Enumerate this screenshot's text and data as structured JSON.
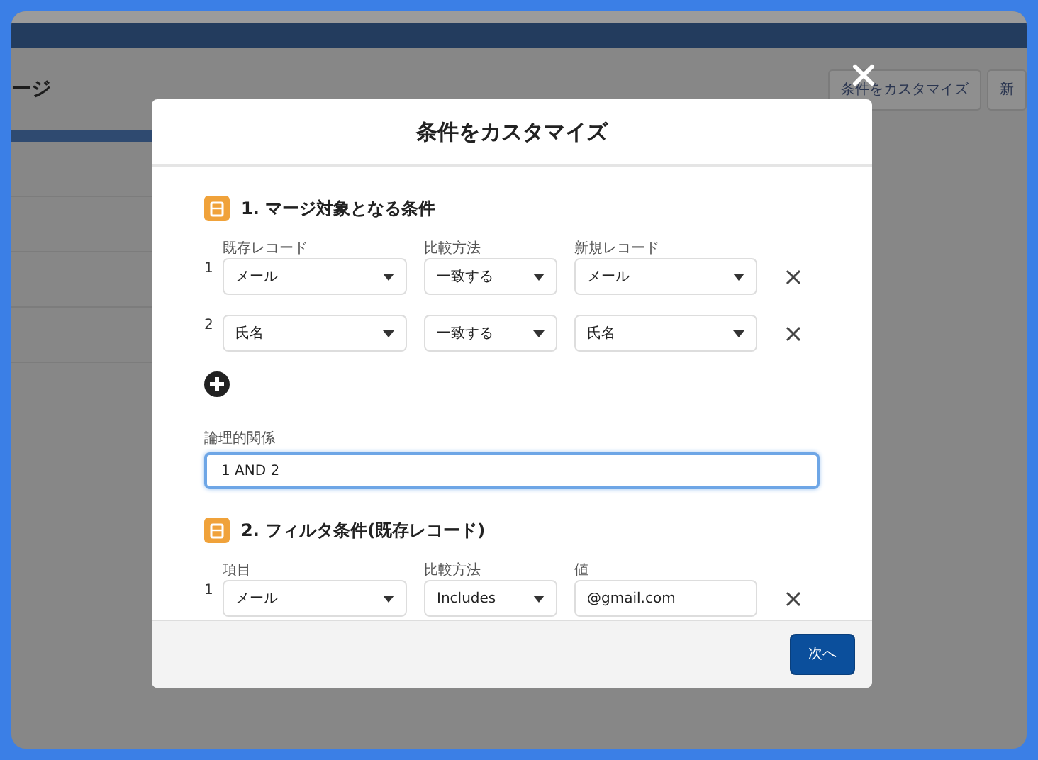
{
  "background": {
    "page_title": "ージ",
    "header_buttons": [
      "条件をカスタマイズ",
      "新"
    ]
  },
  "modal": {
    "title": "条件をカスタマイズ",
    "sections": [
      {
        "heading": "1. マージ対象となる条件",
        "columns": [
          "既存レコード",
          "比較方法",
          "新規レコード"
        ],
        "rows": [
          {
            "number": "1",
            "cells": [
              {
                "kind": "select",
                "value": "メール"
              },
              {
                "kind": "select",
                "value": "一致する"
              },
              {
                "kind": "select",
                "value": "メール"
              }
            ]
          },
          {
            "number": "2",
            "cells": [
              {
                "kind": "select",
                "value": "氏名"
              },
              {
                "kind": "select",
                "value": "一致する"
              },
              {
                "kind": "select",
                "value": "氏名"
              }
            ]
          }
        ],
        "add_row": true,
        "logic": {
          "label": "論理的関係",
          "value": "1 AND 2",
          "focused": true
        }
      },
      {
        "heading": "2. フィルタ条件(既存レコード)",
        "columns": [
          "項目",
          "比較方法",
          "値"
        ],
        "rows": [
          {
            "number": "1",
            "cells": [
              {
                "kind": "select",
                "value": "メール"
              },
              {
                "kind": "select",
                "value": "Includes"
              },
              {
                "kind": "text",
                "value": "@gmail.com"
              }
            ]
          }
        ]
      }
    ],
    "next_button": "次へ"
  }
}
